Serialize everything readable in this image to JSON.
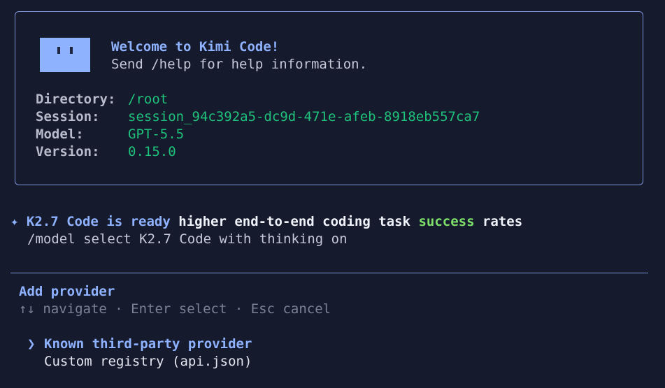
{
  "welcome": {
    "title": "Welcome to Kimi Code!",
    "subtitle": "Send /help for help information.",
    "fields": [
      {
        "label": "Directory:",
        "value": "/root"
      },
      {
        "label": "Session:",
        "value": "session_94c392a5-dc9d-471e-afeb-8918eb557ca7"
      },
      {
        "label": "Model:",
        "value": "GPT-5.5"
      },
      {
        "label": "Version:",
        "value": "0.15.0"
      }
    ]
  },
  "announcement": {
    "bullet": "✦",
    "highlight": "K2.7 Code is ready",
    "text_before": "higher end-to-end coding task",
    "success_word": "success",
    "text_after": "rates",
    "hint": "/model select K2.7 Code with thinking on"
  },
  "provider_menu": {
    "title": "Add provider",
    "help": "↑↓ navigate · Enter select · Esc cancel",
    "cursor": "❯",
    "options": [
      {
        "label": "Known third-party provider",
        "selected": true
      },
      {
        "label": "Custom registry (api.json)",
        "selected": false
      }
    ]
  },
  "colors": {
    "background": "#151a2d",
    "accent": "#8fb2ff",
    "value_green": "#1fc27a",
    "success_green": "#7ee06a",
    "border": "#7f95d6"
  }
}
